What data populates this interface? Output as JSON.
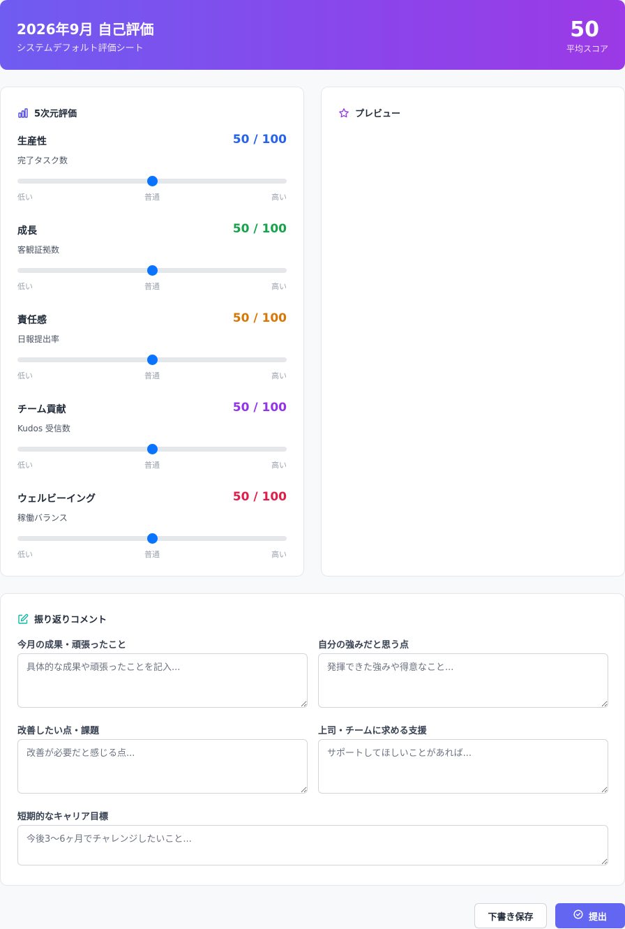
{
  "header": {
    "title": "2026年9月 自己評価",
    "subtitle": "システムデフォルト評価シート",
    "average_score": "50",
    "average_label": "平均スコア"
  },
  "dimensions_card": {
    "title": "5次元評価",
    "icon": "bar-chart-icon",
    "scale_labels": {
      "low": "低い",
      "mid": "普通",
      "high": "高い"
    },
    "items": [
      {
        "name": "生産性",
        "metric": "完了タスク数",
        "value": 50,
        "display": "50 / 100",
        "color": "#2563eb"
      },
      {
        "name": "成長",
        "metric": "客観証拠数",
        "value": 50,
        "display": "50 / 100",
        "color": "#16a34a"
      },
      {
        "name": "責任感",
        "metric": "日報提出率",
        "value": 50,
        "display": "50 / 100",
        "color": "#d97706"
      },
      {
        "name": "チーム貢献",
        "metric": "Kudos 受信数",
        "value": 50,
        "display": "50 / 100",
        "color": "#9333ea"
      },
      {
        "name": "ウェルビーイング",
        "metric": "稼働バランス",
        "value": 50,
        "display": "50 / 100",
        "color": "#e11d48"
      }
    ]
  },
  "preview_card": {
    "title": "プレビュー",
    "icon": "star-icon",
    "accent": "#9333ea"
  },
  "comments_card": {
    "title": "振り返りコメント",
    "icon": "edit-icon",
    "accent": "#14b8a6",
    "fields": {
      "achievements": {
        "label": "今月の成果・頑張ったこと",
        "placeholder": "具体的な成果や頑張ったことを記入...",
        "value": ""
      },
      "strengths": {
        "label": "自分の強みだと思う点",
        "placeholder": "発揮できた強みや得意なこと...",
        "value": ""
      },
      "improvements": {
        "label": "改善したい点・課題",
        "placeholder": "改善が必要だと感じる点...",
        "value": ""
      },
      "support": {
        "label": "上司・チームに求める支援",
        "placeholder": "サポートしてほしいことがあれば...",
        "value": ""
      },
      "career": {
        "label": "短期的なキャリア目標",
        "placeholder": "今後3〜6ヶ月でチャレンジしたいこと...",
        "value": ""
      }
    }
  },
  "actions": {
    "draft_label": "下書き保存",
    "submit_label": "提出",
    "submit_icon": "check-circle-icon"
  }
}
